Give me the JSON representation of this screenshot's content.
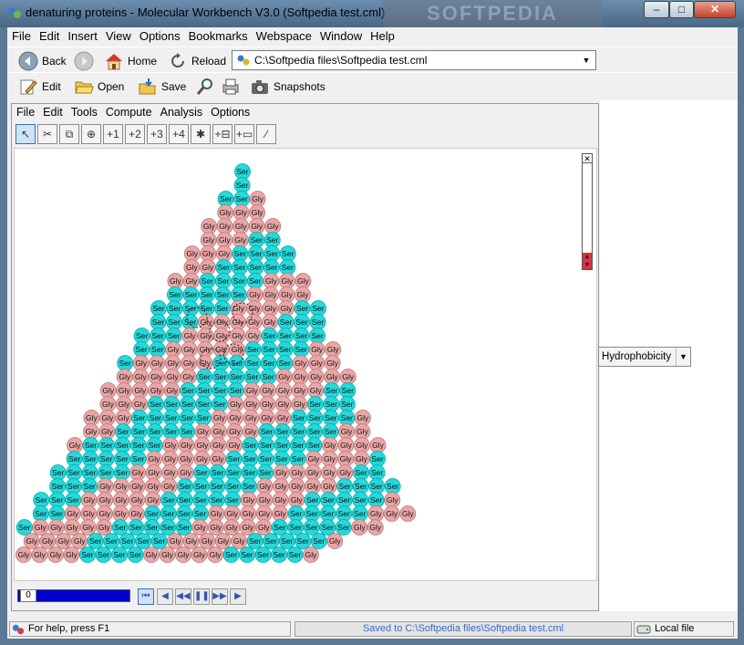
{
  "window": {
    "title": "denaturing proteins - Molecular Workbench V3.0 (Softpedia test.cml)",
    "watermark": "SOFTPEDIA",
    "controls": {
      "minimize": "–",
      "maximize": "□",
      "close": "✕"
    }
  },
  "menubar": [
    "File",
    "Edit",
    "Insert",
    "View",
    "Options",
    "Bookmarks",
    "Webspace",
    "Window",
    "Help"
  ],
  "nav_toolbar": {
    "back": "Back",
    "home": "Home",
    "reload": "Reload",
    "address": "C:\\Softpedia files\\Softpedia test.cml"
  },
  "edit_toolbar": {
    "edit": "Edit",
    "open": "Open",
    "save": "Save",
    "snapshots": "Snapshots"
  },
  "model_menu": [
    "File",
    "Edit",
    "Tools",
    "Compute",
    "Analysis",
    "Options"
  ],
  "model_tools": [
    "↖",
    "✂",
    "⧉",
    "⊕",
    "+1",
    "+2",
    "+3",
    "+4",
    "✱",
    "+⊟",
    "+▭",
    "∕"
  ],
  "molecule": {
    "hydrophobic_label": "Gly",
    "hydrophilic_label": "Ser",
    "hydrophobic_color": "#e8a6a6",
    "hydrophilic_color": "#26d8da"
  },
  "playback": {
    "frame": "0",
    "progress": 1.0
  },
  "property_select": "Hydrophobicity",
  "statusbar": {
    "help": "For help, press F1",
    "saved": "Saved to C:\\Softpedia files\\Softpedia test.cml",
    "mode": "Local file"
  }
}
